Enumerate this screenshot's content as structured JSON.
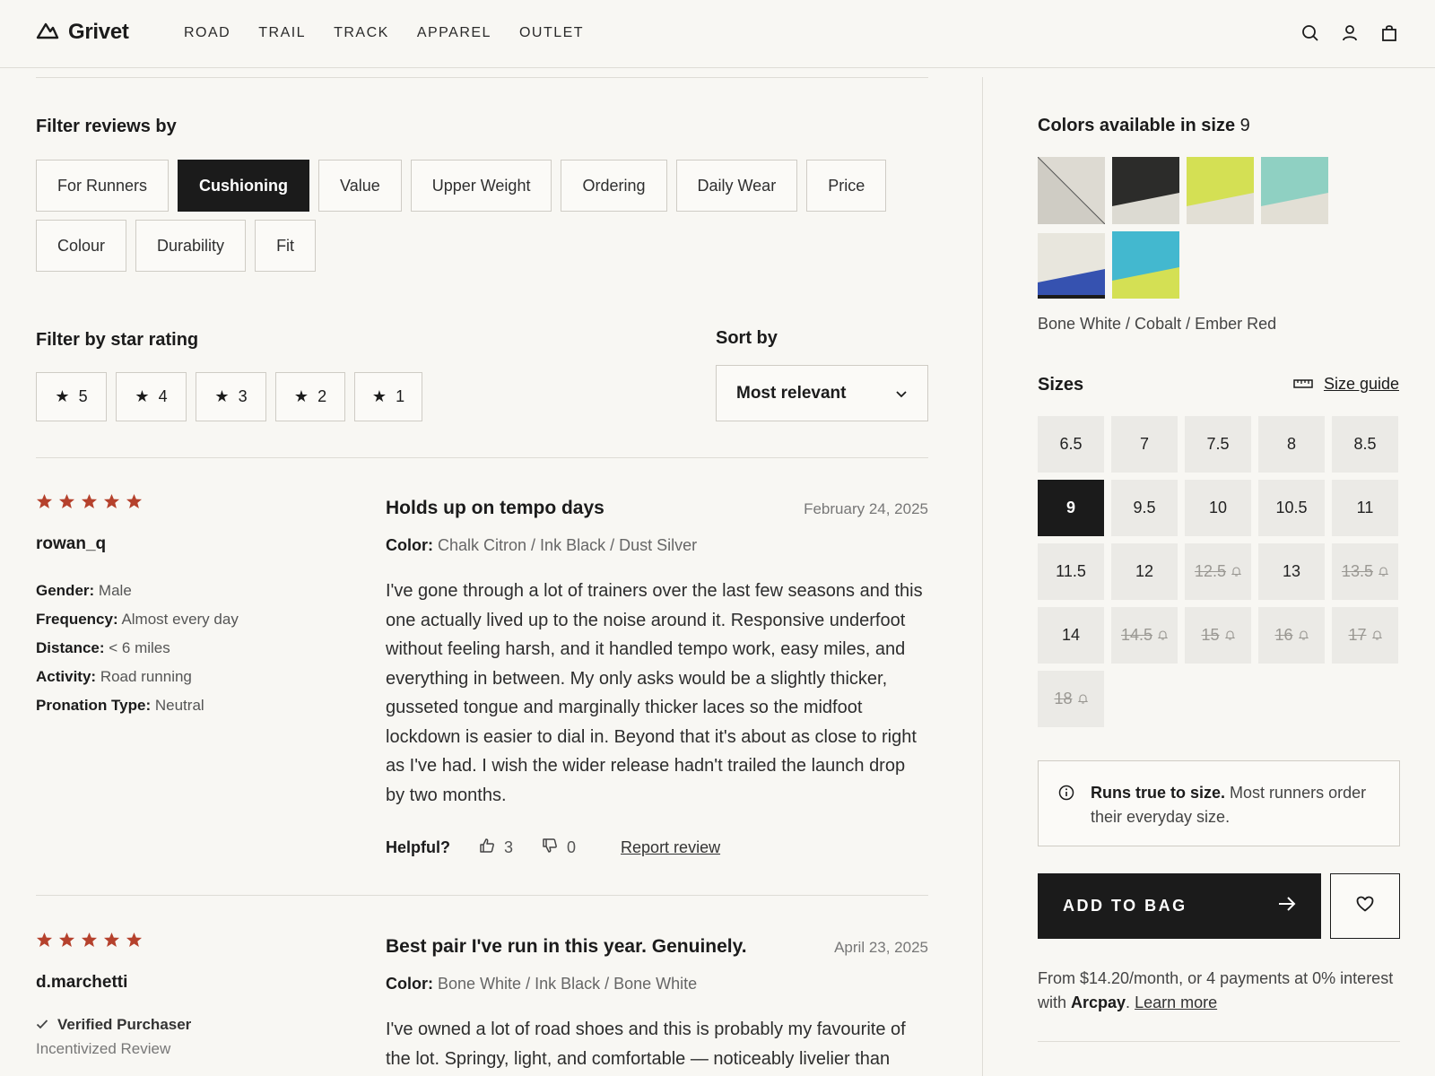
{
  "brand": {
    "name": "Grivet"
  },
  "nav": [
    "ROAD",
    "TRAIL",
    "TRACK",
    "APPAREL",
    "OUTLET"
  ],
  "icons": {
    "search": "search-icon",
    "account": "user-icon",
    "bag": "shopping-bag-icon"
  },
  "filters": {
    "title": "Filter reviews by",
    "row1": [
      "For Runners",
      "Cushioning",
      "Value",
      "Upper Weight",
      "Ordering",
      "Daily Wear",
      "Price"
    ],
    "row2": [
      "Colour",
      "Durability",
      "Fit"
    ],
    "active": "Cushioning"
  },
  "star_filter": {
    "title": "Filter by star rating",
    "options": [
      "5",
      "4",
      "3",
      "2",
      "1"
    ]
  },
  "sort": {
    "title": "Sort by",
    "value": "Most relevant"
  },
  "colors": {
    "star": "#b5412c",
    "accent": "#1b1b1b"
  },
  "reviews": [
    {
      "rating": 5,
      "user": "rowan_q",
      "meta": [
        {
          "label": "Gender:",
          "value": "Male"
        },
        {
          "label": "Frequency:",
          "value": "Almost every day"
        },
        {
          "label": "Distance:",
          "value": "< 6 miles"
        },
        {
          "label": "Activity:",
          "value": "Road running"
        },
        {
          "label": "Pronation Type:",
          "value": "Neutral"
        }
      ],
      "title": "Holds up on tempo days",
      "date": "February 24, 2025",
      "color_label": "Color:",
      "color": "Chalk Citron / Ink Black / Dust Silver",
      "body": "I've gone through a lot of trainers over the last few seasons and this one actually lived up to the noise around it. Responsive underfoot without feeling harsh, and it handled tempo work, easy miles, and everything in between. My only asks would be a slightly thicker, gusseted tongue and marginally thicker laces so the midfoot lockdown is easier to dial in. Beyond that it's about as close to right as I've had. I wish the wider release hadn't trailed the launch drop by two months.",
      "helpful_label": "Helpful?",
      "up": "3",
      "down": "0",
      "report": "Report review"
    },
    {
      "rating": 5,
      "user": "d.marchetti",
      "verified": "Verified Purchaser",
      "incentivized": "Incentivized Review",
      "title": "Best pair I've run in this year. Genuinely.",
      "date": "April 23, 2025",
      "color_label": "Color:",
      "color": "Bone White / Ink Black / Bone White",
      "body": "I've owned a lot of road shoes and this is probably my favourite of the lot. Springy, light, and comfortable — noticeably livelier than"
    }
  ],
  "product": {
    "colors_title": "Colors available in size",
    "colors_size": "9",
    "swatches": [
      {
        "name": "Chalk / Dust",
        "top": "#dddad2",
        "bottom": "#cfccc4",
        "selected": false
      },
      {
        "name": "Ink Black",
        "top": "#2c2c2a",
        "bottom": "#dcdad2",
        "selected": false
      },
      {
        "name": "Citron",
        "top": "#d4e054",
        "bottom": "#e2dfd5",
        "selected": false
      },
      {
        "name": "Seafoam",
        "top": "#8fd0c2",
        "bottom": "#e2dfd5",
        "selected": false
      },
      {
        "name": "Cobalt",
        "top": "#e8e6dd",
        "bottom": "#3652b0",
        "selected": true
      },
      {
        "name": "Aqua Citron",
        "top": "#43b8cf",
        "bottom": "#d4e054",
        "selected": false
      }
    ],
    "selected_color": "Bone White / Cobalt / Ember Red",
    "sizes_title": "Sizes",
    "size_guide": "Size guide",
    "sizes": [
      {
        "v": "6.5",
        "oos": false
      },
      {
        "v": "7",
        "oos": false
      },
      {
        "v": "7.5",
        "oos": false
      },
      {
        "v": "8",
        "oos": false
      },
      {
        "v": "8.5",
        "oos": false
      },
      {
        "v": "9",
        "oos": false,
        "sel": true
      },
      {
        "v": "9.5",
        "oos": false
      },
      {
        "v": "10",
        "oos": false
      },
      {
        "v": "10.5",
        "oos": false
      },
      {
        "v": "11",
        "oos": false
      },
      {
        "v": "11.5",
        "oos": false
      },
      {
        "v": "12",
        "oos": false
      },
      {
        "v": "12.5",
        "oos": true
      },
      {
        "v": "13",
        "oos": false
      },
      {
        "v": "13.5",
        "oos": true
      },
      {
        "v": "14",
        "oos": false
      },
      {
        "v": "14.5",
        "oos": true
      },
      {
        "v": "15",
        "oos": true
      },
      {
        "v": "16",
        "oos": true
      },
      {
        "v": "17",
        "oos": true
      },
      {
        "v": "18",
        "oos": true
      }
    ],
    "fit_strong": "Runs true to size.",
    "fit_text": " Most runners order their everyday size.",
    "add_to_bag": "ADD TO BAG",
    "finance_pre": "From $14.20/month, or 4 payments at 0% interest with ",
    "finance_brand": "Arcpay",
    "finance_post": ". ",
    "learn_more": "Learn more"
  }
}
